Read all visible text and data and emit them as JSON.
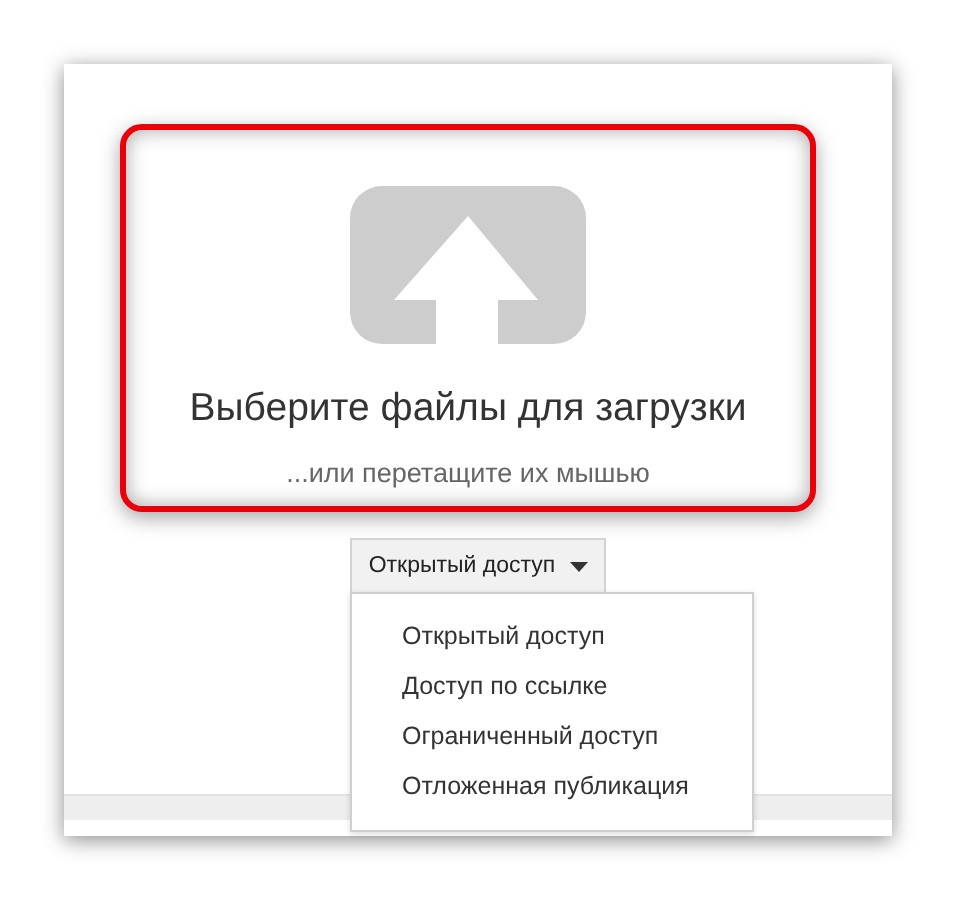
{
  "upload": {
    "title": "Выберите файлы для загрузки",
    "hint": "...или перетащите их мышью"
  },
  "privacy": {
    "label": "Открытый доступ",
    "expanded": true,
    "options": [
      {
        "label": "Открытый доступ"
      },
      {
        "label": "Доступ по ссылке"
      },
      {
        "label": "Ограниченный доступ"
      },
      {
        "label": "Отложенная публикация"
      }
    ]
  }
}
